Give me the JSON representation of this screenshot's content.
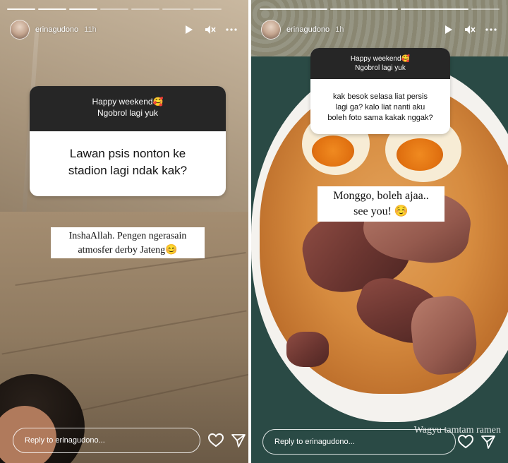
{
  "left_story": {
    "username": "erinagudono",
    "time": "11h",
    "question_header_line1": "Happy weekend🥰",
    "question_header_line2": "Ngobrol lagi yuk",
    "question_text_line1": "Lawan psis nonton ke",
    "question_text_line2": "stadion lagi ndak kak?",
    "answer_line1": "InshaAllah. Pengen ngerasain",
    "answer_line2": "atmosfer derby Jateng😊",
    "reply_placeholder": "Reply to erinagudono..."
  },
  "right_story": {
    "username": "erinagudono",
    "time": "1h",
    "question_header_line1": "Happy weekend🥰",
    "question_header_line2": "Ngobrol lagi yuk",
    "question_text_line1": "kak besok selasa liat persis",
    "question_text_line2": "lagi ga? kalo liat nanti aku",
    "question_text_line3": "boleh foto sama kakak nggak?",
    "answer_line1": "Monggo, boleh ajaa..",
    "answer_line2": "see you! ☺️",
    "reply_placeholder": "Reply to erinagudono...",
    "watermark": "Wagyu tamtam ramen"
  },
  "icons": {
    "play": "play-icon",
    "mute": "mute-icon",
    "more": "more-icon",
    "heart": "heart-icon",
    "send": "send-icon"
  },
  "colors": {
    "question_header_bg": "#262626",
    "card_bg": "#ffffff"
  }
}
